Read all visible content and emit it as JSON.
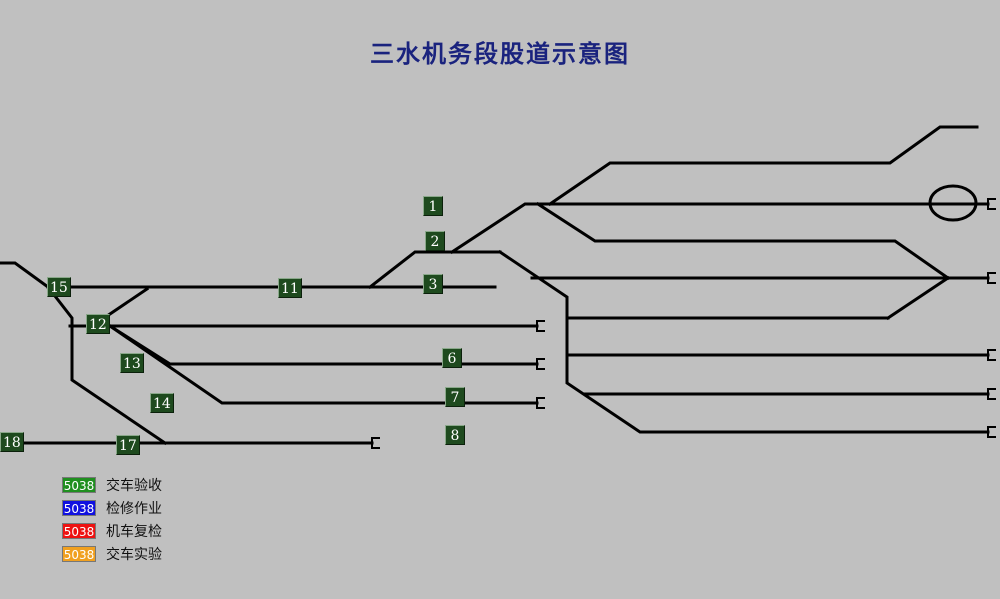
{
  "title": "三水机务段股道示意图",
  "track_labels": [
    {
      "id": "1",
      "text": "1"
    },
    {
      "id": "2",
      "text": "2"
    },
    {
      "id": "3",
      "text": "3"
    },
    {
      "id": "6",
      "text": "6"
    },
    {
      "id": "7",
      "text": "7"
    },
    {
      "id": "8",
      "text": "8"
    },
    {
      "id": "11",
      "text": "11"
    },
    {
      "id": "12",
      "text": "12"
    },
    {
      "id": "13",
      "text": "13"
    },
    {
      "id": "14",
      "text": "14"
    },
    {
      "id": "15",
      "text": "15"
    },
    {
      "id": "17",
      "text": "17"
    },
    {
      "id": "18",
      "text": "18"
    }
  ],
  "legend": [
    {
      "code": "5038",
      "text": "交车验收",
      "color": "#1f8f1f"
    },
    {
      "code": "5038",
      "text": "检修作业",
      "color": "#1010e0"
    },
    {
      "code": "5038",
      "text": "机车复检",
      "color": "#ee1111"
    },
    {
      "code": "5038",
      "text": "交车实验",
      "color": "#f0a020"
    }
  ],
  "colors": {
    "background": "#c0c0c0",
    "track": "#000000",
    "title": "#1a237e",
    "label_bg": "#1e4a1e"
  }
}
